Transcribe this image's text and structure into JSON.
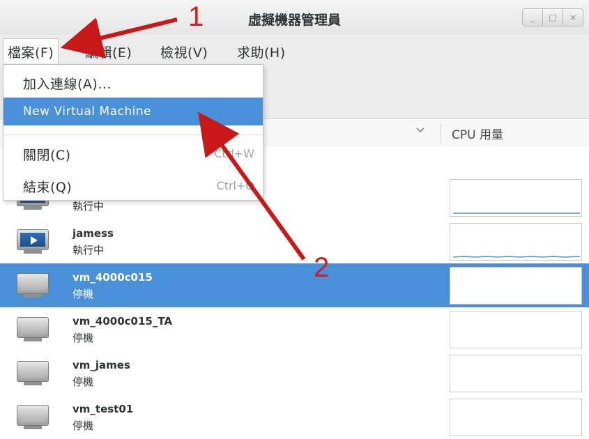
{
  "window": {
    "title": "虛擬機器管理員",
    "buttons": [
      "_",
      "□",
      "×"
    ]
  },
  "menubar": {
    "items": [
      "檔案(F)",
      "編輯(E)",
      "檢視(V)",
      "求助(H)"
    ]
  },
  "file_menu": {
    "items": [
      {
        "label": "加入連線(A)...",
        "accel": ""
      },
      {
        "label": "New Virtual Machine",
        "accel": ""
      },
      {
        "label": "關閉(C)",
        "accel": "Ctrl+W"
      },
      {
        "label": "結束(Q)",
        "accel": "Ctrl+Q"
      }
    ]
  },
  "columns": {
    "dropdown_icon": "chevron-down-icon",
    "cpu": "CPU 用量"
  },
  "vms": [
    {
      "name": "",
      "status": "執行中",
      "state": "running"
    },
    {
      "name": "jamess",
      "status": "執行中",
      "state": "running"
    },
    {
      "name": "vm_4000c015",
      "status": "停機",
      "state": "stopped",
      "selected": true
    },
    {
      "name": "vm_4000c015_TA",
      "status": "停機",
      "state": "stopped"
    },
    {
      "name": "vm_james",
      "status": "停機",
      "state": "stopped"
    },
    {
      "name": "vm_test01",
      "status": "停機",
      "state": "stopped"
    }
  ],
  "annotations": {
    "label_1": "1",
    "label_2": "2",
    "color": "#c81818"
  },
  "colors": {
    "selection": "#4a90d9",
    "graph_line": "#4a90d9"
  }
}
